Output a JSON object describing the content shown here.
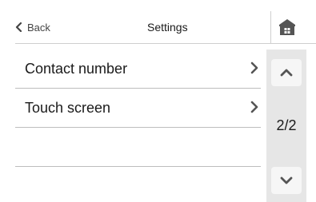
{
  "header": {
    "back_label": "Back",
    "title": "Settings",
    "home_icon": "home-icon"
  },
  "list": {
    "items": [
      {
        "label": "Contact number",
        "icon": "chevron-right-icon"
      },
      {
        "label": "Touch screen",
        "icon": "chevron-right-icon"
      },
      {
        "label": ""
      }
    ]
  },
  "scroller": {
    "page_indicator": "2/2",
    "up_icon": "chevron-up-icon",
    "down_icon": "chevron-down-icon"
  },
  "colors": {
    "icon": "#555555",
    "scroller_bg": "#e6e6e6",
    "scroll_button_bg": "#f6f6f6",
    "divider": "#bdbdbd"
  }
}
